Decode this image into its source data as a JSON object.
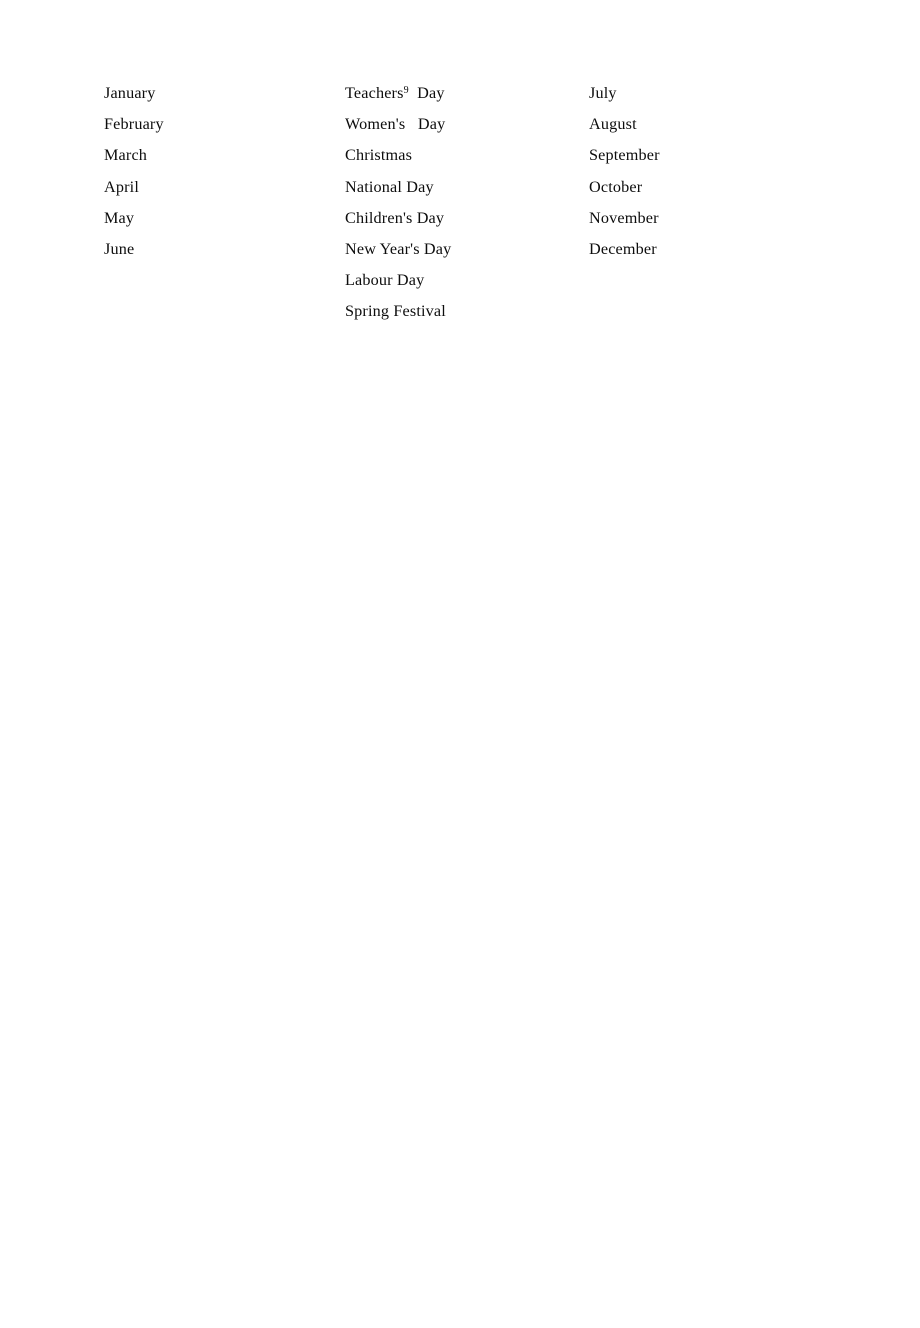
{
  "document": {
    "background_color": "#ffffff",
    "text_color": "#0d0d0d",
    "columns": [
      {
        "name": "months-first-half",
        "entries": [
          {
            "text": "January"
          },
          {
            "text": "February"
          },
          {
            "text": "March"
          },
          {
            "text": "April"
          },
          {
            "text": "May"
          },
          {
            "text": "June"
          }
        ]
      },
      {
        "name": "holidays",
        "entries": [
          {
            "text": "Teachers",
            "sup": "9",
            "tail": "  Day"
          },
          {
            "text": "Women's   Day"
          },
          {
            "text": "Christmas"
          },
          {
            "text": "National Day"
          },
          {
            "text": "Children's Day"
          },
          {
            "text": "New Year's Day"
          },
          {
            "text": "Labour Day"
          },
          {
            "text": "Spring Festival"
          }
        ]
      },
      {
        "name": "months-second-half",
        "entries": [
          {
            "text": "July"
          },
          {
            "text": "August"
          },
          {
            "text": "September"
          },
          {
            "text": "October"
          },
          {
            "text": "November"
          },
          {
            "text": "December"
          }
        ]
      }
    ]
  }
}
